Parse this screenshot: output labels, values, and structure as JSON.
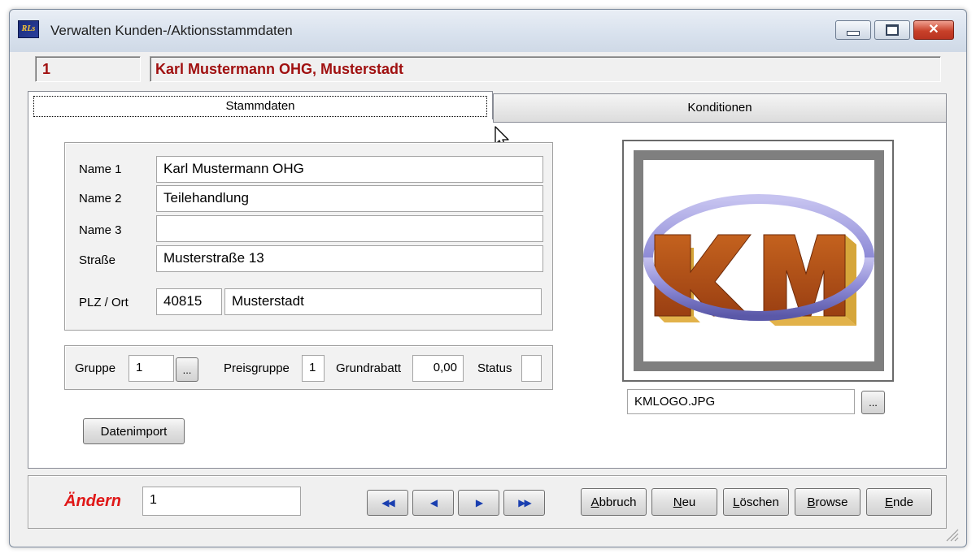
{
  "window": {
    "title": "Verwalten Kunden-/Aktionsstammdaten",
    "icon": "app-logo-icon",
    "icon_text": "RLs",
    "controls": {
      "minimize": "minimize-icon",
      "maximize": "maximize-icon",
      "close": "close-icon"
    }
  },
  "header": {
    "number": "1",
    "name": "Karl Mustermann OHG, Musterstadt",
    "text_color": "#a01010"
  },
  "tabs": [
    {
      "label": "Stammdaten",
      "active": true
    },
    {
      "label": "Konditionen",
      "active": false
    }
  ],
  "address": {
    "name1": {
      "label": "Name 1",
      "value": "Karl Mustermann OHG"
    },
    "name2": {
      "label": "Name 2",
      "value": "Teilehandlung"
    },
    "name3": {
      "label": "Name 3",
      "value": ""
    },
    "street": {
      "label": "Straße",
      "value": "Musterstraße  13"
    },
    "city": {
      "label": "PLZ  / Ort",
      "zip": "40815",
      "city": "Musterstadt"
    }
  },
  "classification": {
    "group_label": "Gruppe",
    "group_value": "1",
    "group_browse": "...",
    "pricegroup_label": "Preisgruppe",
    "pricegroup_value": "1",
    "discount_label": "Grundrabatt",
    "discount_value": "0,00",
    "status_label": "Status",
    "status_value": ""
  },
  "import_button": "Datenimport",
  "logo": {
    "text": "KM",
    "filename": "KMLOGO.JPG",
    "browse": "...",
    "colors": {
      "letters": "#b5521c",
      "ring": "#8d8ad6"
    }
  },
  "bottom": {
    "mode_label": "Ändern",
    "mode_color": "#e01818",
    "record_value": "1",
    "nav": [
      "first-record-icon",
      "previous-record-icon",
      "next-record-icon",
      "last-record-icon"
    ],
    "buttons": [
      {
        "first": "A",
        "rest": "bbruch"
      },
      {
        "first": "N",
        "rest": "eu"
      },
      {
        "first": "L",
        "rest": "öschen"
      },
      {
        "first": "B",
        "rest": "rowse"
      },
      {
        "first": "E",
        "rest": "nde"
      }
    ]
  }
}
